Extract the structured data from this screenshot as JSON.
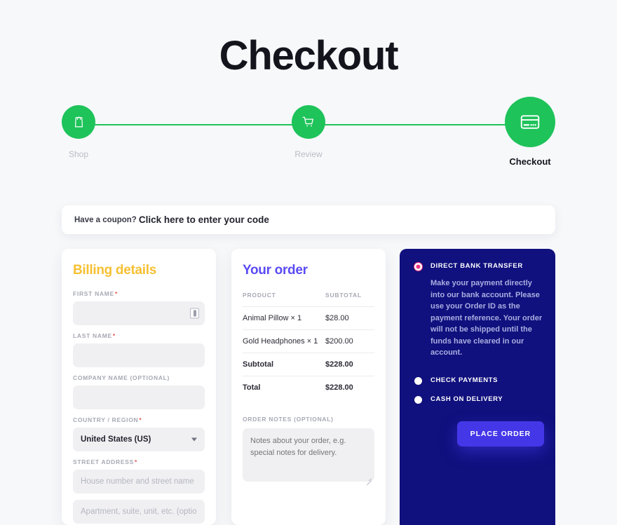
{
  "page": {
    "title": "Checkout",
    "background": "#f7f8fa",
    "accent_green": "#1ec35a",
    "accent_yellow": "#f6c033",
    "accent_purple": "#5b4cf5",
    "panel_navy": "#10107e",
    "radio_selected": "#f0337c"
  },
  "stepper": {
    "steps": [
      {
        "label": "Shop",
        "icon": "shopping-bag-icon",
        "state": "complete"
      },
      {
        "label": "Review",
        "icon": "shopping-cart-icon",
        "state": "complete"
      },
      {
        "label": "Checkout",
        "icon": "credit-card-icon",
        "state": "active"
      }
    ]
  },
  "coupon": {
    "prompt": "Have a coupon?",
    "link": "Click here to enter your code"
  },
  "billing": {
    "title": "Billing details",
    "fields": [
      {
        "label": "FIRST NAME",
        "required": true,
        "value": "",
        "placeholder": ""
      },
      {
        "label": "LAST NAME",
        "required": true,
        "value": "",
        "placeholder": ""
      },
      {
        "label": "COMPANY NAME (OPTIONAL)",
        "required": false,
        "value": "",
        "placeholder": ""
      },
      {
        "label": "COUNTRY / REGION",
        "required": true,
        "value": "United States (US)"
      },
      {
        "label": "STREET ADDRESS",
        "required": true,
        "value": "",
        "placeholder": "House number and street name"
      }
    ],
    "street_line2_placeholder": "Apartment, suite, unit, etc. (optional)",
    "required_mark": "*"
  },
  "order": {
    "title": "Your order",
    "columns": [
      "PRODUCT",
      "SUBTOTAL"
    ],
    "rows": [
      {
        "product": "Animal Pillow  × 1",
        "subtotal": "$28.00",
        "emphasis": false
      },
      {
        "product": "Gold Headphones  × 1",
        "subtotal": "$200.00",
        "emphasis": false
      },
      {
        "product": "Subtotal",
        "subtotal": "$228.00",
        "emphasis": true
      },
      {
        "product": "Total",
        "subtotal": "$228.00",
        "emphasis": true
      }
    ],
    "notes_label": "ORDER NOTES (OPTIONAL)",
    "notes_value": "",
    "notes_placeholder": "Notes about your order, e.g. special notes for delivery."
  },
  "payment": {
    "selected": "DIRECT BANK TRANSFER",
    "options": [
      {
        "label": "DIRECT BANK TRANSFER",
        "description": "Make your payment directly into our bank account. Please use your Order ID as the payment reference. Your order will not be shipped until the funds have cleared in our account."
      },
      {
        "label": "CHECK PAYMENTS",
        "description": ""
      },
      {
        "label": "CASH ON DELIVERY",
        "description": ""
      }
    ],
    "place_order_label": "Place order"
  }
}
